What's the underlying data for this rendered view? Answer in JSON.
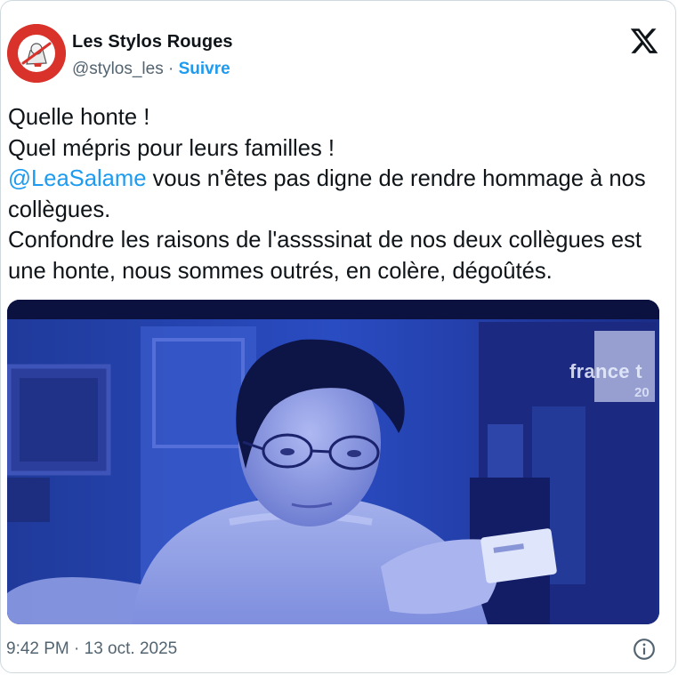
{
  "author": {
    "name": "Les Stylos Rouges",
    "handle": "@stylos_les",
    "separator": "·",
    "follow_label": "Suivre",
    "avatar_text_top": "L'ÉDUCATION",
    "avatar_text_bottom": "EN COLÈRE !"
  },
  "tweet": {
    "line1": "Quelle honte !",
    "line2": "Quel mépris pour leurs familles !",
    "mention": "@LeaSalame",
    "line3_rest": " vous n'êtes pas digne de rendre hommage à nos collègues.",
    "line4": "Confondre les raisons de l'assssinat de nos deux collègues est une honte, nous sommes outrés, en colère, dégoûtés."
  },
  "media": {
    "channel_logo": "france t",
    "channel_sub": "20"
  },
  "footer": {
    "timestamp": "9:42 PM · 13 oct. 2025"
  },
  "icons": {
    "brand": "x-logo-icon",
    "info": "info-icon"
  },
  "colors": {
    "link": "#1d9bf0",
    "text": "#0f1419",
    "muted": "#536471",
    "avatar_red": "#d8322b"
  }
}
